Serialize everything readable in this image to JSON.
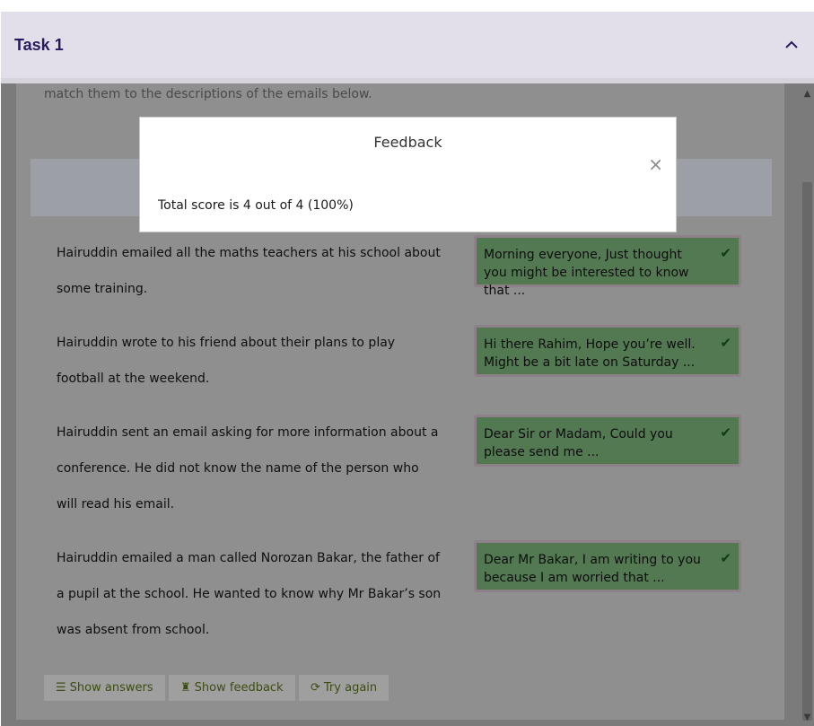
{
  "task": {
    "title": "Task 1",
    "toggle_icon": "chevron-up-icon"
  },
  "intro": "match them to the descriptions of the emails below.",
  "items": [
    {
      "description": "Hairuddin emailed all the maths teachers at his school about some training.",
      "answer": "Morning everyone, Just thought you might be interested to know that ...",
      "status": "correct"
    },
    {
      "description": "Hairuddin wrote to his friend about their plans to play football at the weekend.",
      "answer": "Hi there Rahim, Hope you’re well. Might be a bit late on Saturday ...",
      "status": "correct"
    },
    {
      "description": "Hairuddin sent an email asking for more information about a conference. He did not know the name of the person who will read his email.",
      "answer": "Dear Sir or Madam, Could you please send me ...",
      "status": "correct"
    },
    {
      "description": "Hairuddin emailed a man called Norozan Bakar, the father of a pupil at the school. He wanted to know why Mr Bakar’s son was absent from school.",
      "answer": "Dear Mr Bakar, I am writing to you because I am worried that ...",
      "status": "correct"
    }
  ],
  "buttons": {
    "show_answers": "Show answers",
    "show_feedback": "Show feedback",
    "try_again": "Try again"
  },
  "modal": {
    "title": "Feedback",
    "close_glyph": "×",
    "score_text": "Total score is 4 out of 4 (100%)"
  },
  "colors": {
    "header_bg": "#e2dfea",
    "title_color": "#2a1a5e",
    "correct_card_bg": "#537953",
    "button_text": "#3b4d11"
  }
}
